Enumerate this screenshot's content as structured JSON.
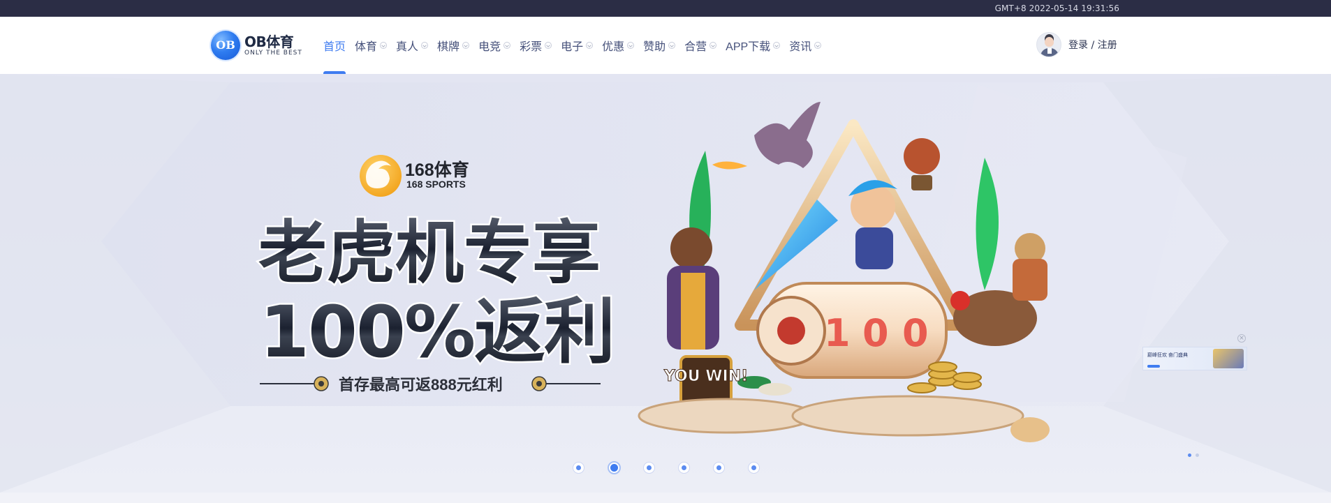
{
  "topbar": {
    "time": "GMT+8 2022-05-14 19:31:56"
  },
  "header": {
    "logo": {
      "badge": "OB",
      "name": "OB体育",
      "tagline": "ONLY THE BEST"
    },
    "nav": [
      {
        "label": "首页",
        "active": true
      },
      {
        "label": "体育"
      },
      {
        "label": "真人"
      },
      {
        "label": "棋牌"
      },
      {
        "label": "电竞"
      },
      {
        "label": "彩票"
      },
      {
        "label": "电子"
      },
      {
        "label": "优惠"
      },
      {
        "label": "赞助"
      },
      {
        "label": "合营"
      },
      {
        "label": "APP下载"
      },
      {
        "label": "资讯"
      }
    ],
    "auth": "登录 / 注册"
  },
  "banner": {
    "brand_cn": "168体育",
    "brand_en": "168 SPORTS",
    "headline_1": "老虎机专享",
    "headline_2": "100%返利",
    "subline": "首存最高可返888元红利",
    "slot_digits": [
      "1",
      "0",
      "0"
    ],
    "badge": "YOU WIN!",
    "slide_count": 6,
    "active_slide": 2
  },
  "promo_float": {
    "title": "巅峰狂欢 奋门盛典",
    "subtitle": ""
  },
  "colors": {
    "accent": "#3f7cf0",
    "topbar": "#2b2d45",
    "nav_text": "#45507a"
  }
}
